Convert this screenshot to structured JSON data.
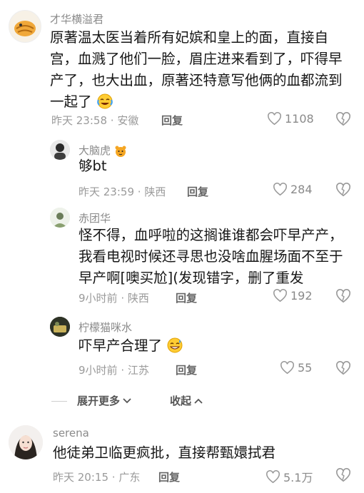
{
  "comments": [
    {
      "username": "才华横溢君",
      "text": "原著温太医当着所有妃嫔和皇上的面，直接自宫，血溅了他们一脸，眉庄进来看到了，吓得早产了，也大出血，原著还特意写他俩的血都流到一起了",
      "time": "昨天 23:58",
      "location": "安徽",
      "reply_label": "回复",
      "likes": "1108",
      "emoji": "laughing-crying-emoji"
    }
  ],
  "replies": [
    {
      "username": "大脑虎",
      "username_badge": "tiger-emoji",
      "text": "够bt",
      "time": "昨天 23:59",
      "location": "陕西",
      "reply_label": "回复",
      "likes": "284"
    },
    {
      "username": "赤团华",
      "text": "怪不得，血呼啦的这搁谁谁都会吓早产产，我看电视时候还寻思也没啥血腥场面不至于早产啊[噢买尬](发现错字，删了重发",
      "time": "9小时前",
      "location": "陕西",
      "reply_label": "回复",
      "likes": "192"
    },
    {
      "username": "柠檬猫咪水",
      "text": "吓早产合理了",
      "time": "9小时前",
      "location": "江苏",
      "reply_label": "回复",
      "likes": "55",
      "emoji": "sweat-smile-emoji"
    }
  ],
  "thread_controls": {
    "expand_label": "展开更多",
    "collapse_label": "收起"
  },
  "last_comment": {
    "username": "serena",
    "text": "他徒弟卫临更疯批，直接帮甄嬛拭君",
    "time": "昨天 20:15",
    "location": "广东",
    "reply_label": "回复",
    "likes": "5.1万"
  },
  "meta_separator": "·"
}
